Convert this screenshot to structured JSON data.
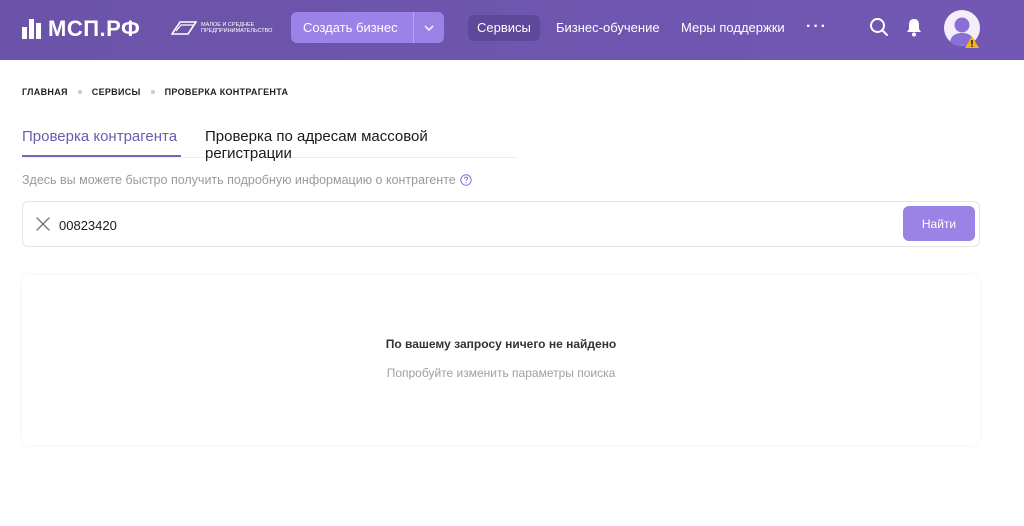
{
  "header": {
    "logo_text": "МСП.РФ",
    "gov_logo_text": "МАЛОЕ И СРЕДНЕЕ ПРЕДПРИНИМАТЕЛЬСТВО",
    "create_button_label": "Создать бизнес",
    "nav": [
      {
        "label": "Сервисы",
        "active": true
      },
      {
        "label": "Бизнес-обучение",
        "active": false
      },
      {
        "label": "Меры поддержки",
        "active": false
      }
    ],
    "more_label": "···",
    "icons": [
      "search-icon",
      "bell-icon",
      "avatar",
      "warning-icon"
    ]
  },
  "breadcrumb": [
    "ГЛАВНАЯ",
    "СЕРВИСЫ",
    "ПРОВЕРКА КОНТРАГЕНТА"
  ],
  "tabs": [
    {
      "label": "Проверка контрагента",
      "active": true
    },
    {
      "label": "Проверка по адресам массовой регистрации",
      "active": false
    }
  ],
  "hint": "Здесь вы можете быстро получить подробную информацию о контрагенте",
  "search": {
    "value": "00823420",
    "button_label": "Найти"
  },
  "result": {
    "title": "По вашему запросу ничего не найдено",
    "subtitle": "Попробуйте изменить параметры поиска"
  },
  "colors": {
    "header_bg": "#6d55ae",
    "accent": "#9b82e6",
    "tab_active": "#6f5ab3",
    "warning": "#f2b418"
  }
}
